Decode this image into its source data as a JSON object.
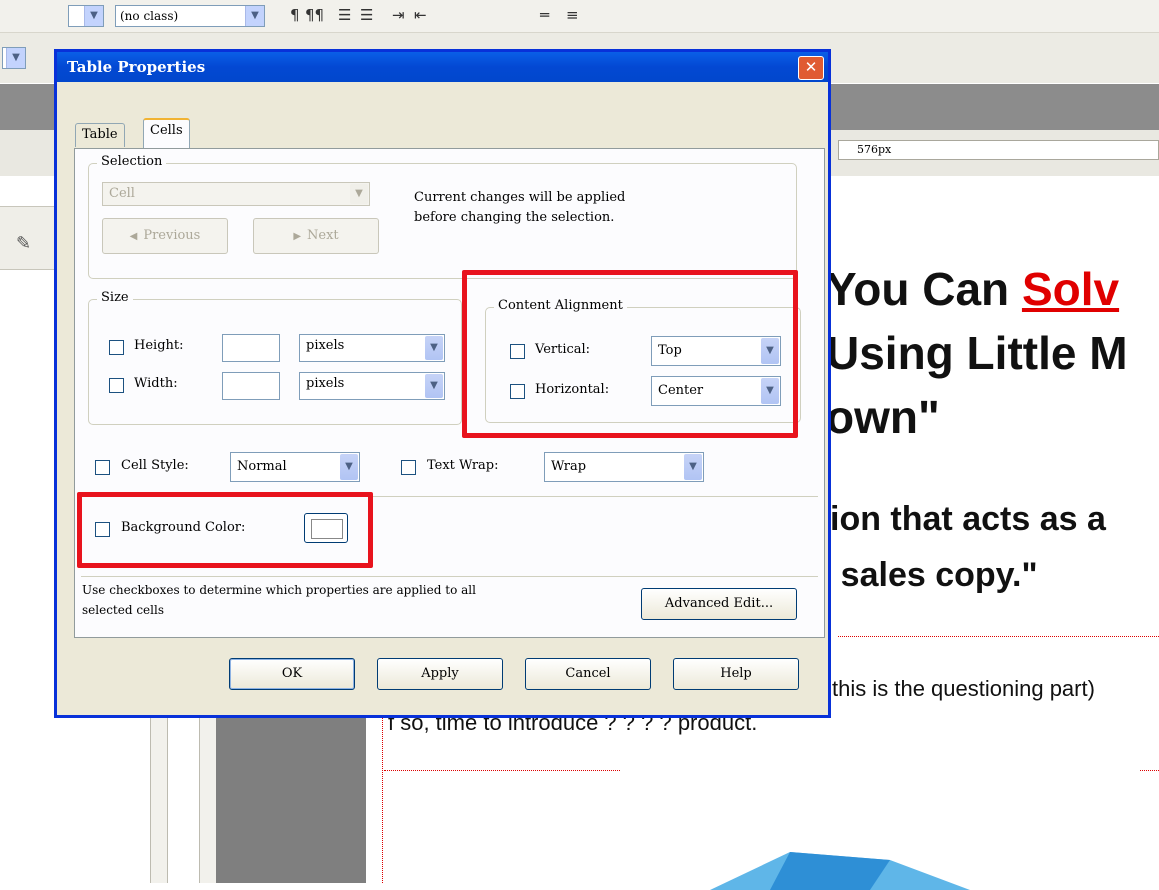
{
  "app": {
    "toolbar": {
      "class_combo": "(no class)",
      "format_glyphs": [
        "¶",
        "¶¶",
        "☰",
        "☰",
        "⇥",
        "⇤",
        "═",
        "≡"
      ]
    },
    "ruler_value": "576px",
    "ruler_marker": "◁⊠▷"
  },
  "document": {
    "heading_line1_pre": "You Can ",
    "heading_line1_red": "Solv",
    "heading_line2": "Using Little M",
    "heading_line3": "own\"",
    "sub_line1": "ion that acts as a",
    "sub_line2": "r sales copy.\"",
    "body_line1": "this is the questioning part)",
    "body_line2": "f so, time to introduce ? ? ? ? product."
  },
  "dialog": {
    "title": "Table Properties",
    "close_glyph": "✕",
    "tabs": [
      {
        "label": "Table"
      },
      {
        "label": "Cells"
      }
    ],
    "selection": {
      "group_label": "Selection",
      "combo_value": "Cell",
      "prev_label": "Previous",
      "next_label": "Next",
      "prev_glyph": "◀",
      "next_glyph": "▶",
      "info_line1": "Current changes will be applied",
      "info_line2": "before changing the selection."
    },
    "size": {
      "group_label": "Size",
      "height_label": "Height:",
      "width_label": "Width:",
      "height_unit": "pixels",
      "width_unit": "pixels"
    },
    "alignment": {
      "group_label": "Content Alignment",
      "vertical_label": "Vertical:",
      "horizontal_label": "Horizontal:",
      "vertical_value": "Top",
      "horizontal_value": "Center"
    },
    "cell_style_label": "Cell Style:",
    "cell_style_value": "Normal",
    "text_wrap_label": "Text Wrap:",
    "text_wrap_value": "Wrap",
    "background_color_label": "Background Color:",
    "help_line1": "Use checkboxes to determine which properties are applied to all",
    "help_line2": "selected cells",
    "advanced_edit_label": "Advanced Edit...",
    "buttons": {
      "ok": "OK",
      "apply": "Apply",
      "cancel": "Cancel",
      "help": "Help"
    }
  },
  "colors": {
    "highlight_box": "#e8131d",
    "title_bar": "#0a5fe7",
    "heading_red": "#e00000"
  }
}
